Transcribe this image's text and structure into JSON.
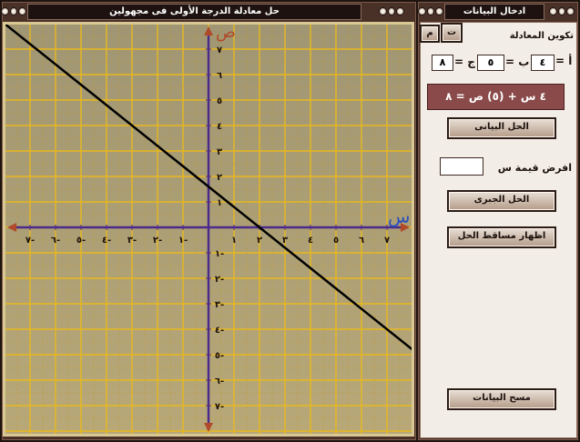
{
  "graph_window": {
    "title": "حل معادلة الدرجة الأولى فى مجهولين"
  },
  "data_window": {
    "title": "ادخال البيانات"
  },
  "tabs": [
    "ت",
    "م"
  ],
  "equation_form": {
    "heading": "تكوين المعادلة",
    "label_a": "أ =",
    "label_b": "ب =",
    "label_c": "ج =",
    "a": "٤",
    "b": "٥",
    "c": "٨"
  },
  "equation_display": "٤ س + (٥) ص = ٨",
  "buttons": {
    "graphical": "الحل البيانى",
    "algebraic": "الحل الجبرى",
    "projections": "اظهار مساقط الحل",
    "clear": "مسح البيانات"
  },
  "assume_x": {
    "label": "افرض قيمة س",
    "value": ""
  },
  "axes": {
    "x_label": "س",
    "y_label": "ص",
    "x_ticks": [
      "٧-",
      "٦-",
      "٥-",
      "٤-",
      "٣-",
      "٢-",
      "١-",
      "١",
      "٢",
      "٣",
      "٤",
      "٥",
      "٦",
      "٧"
    ],
    "y_ticks": [
      "٧",
      "٦",
      "٥",
      "٤",
      "٣",
      "٢",
      "١",
      "١-",
      "٢-",
      "٣-",
      "٤-",
      "٥-",
      "٦-",
      "٧-"
    ]
  },
  "chart_data": {
    "type": "line",
    "x_range": [
      -8,
      8
    ],
    "y_range": [
      -8,
      8
    ],
    "grid": true,
    "line": {
      "a": 4,
      "b": 5,
      "c": 8,
      "color": "#000000"
    },
    "x_axis_color": "#4a2b8c",
    "y_axis_color": "#4a2b8c"
  }
}
